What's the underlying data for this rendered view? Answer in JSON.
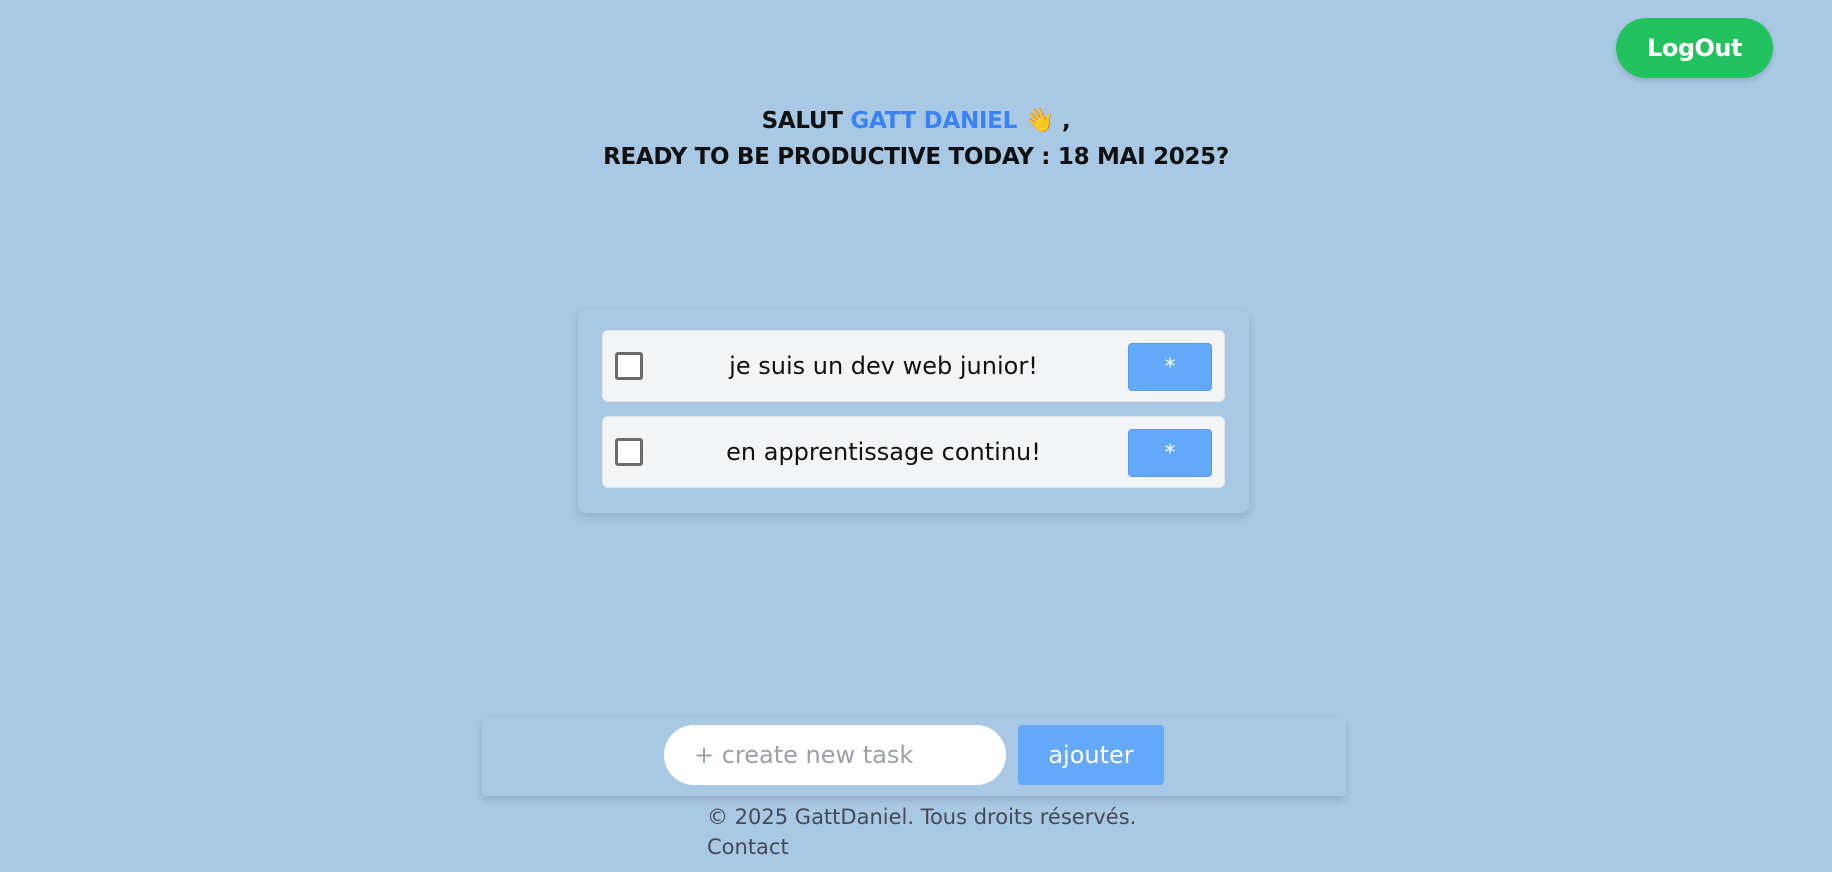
{
  "header": {
    "logout_label": "LogOut"
  },
  "greeting": {
    "salutation": "SALUT",
    "user_name": "GATT DANIEL",
    "wave_emoji": "👋",
    "comma": ",",
    "prompt": "READY TO BE PRODUCTIVE TODAY : 18 MAI 2025?"
  },
  "tasks": [
    {
      "text": "je suis un dev web junior!",
      "checked": false,
      "action_label": "*"
    },
    {
      "text": "en apprentissage continu!",
      "checked": false,
      "action_label": "*"
    }
  ],
  "new_task": {
    "placeholder": "+ create new task",
    "value": "",
    "add_label": "ajouter"
  },
  "footer": {
    "copyright": "© 2025 GattDaniel. Tous droits réservés.",
    "contact_label": "Contact"
  },
  "colors": {
    "background": "#a8c8e4",
    "logout_green": "#22c35e",
    "accent_blue": "#3b82f6",
    "button_blue": "#64a8f9",
    "task_item_bg": "#f3f4f6"
  }
}
